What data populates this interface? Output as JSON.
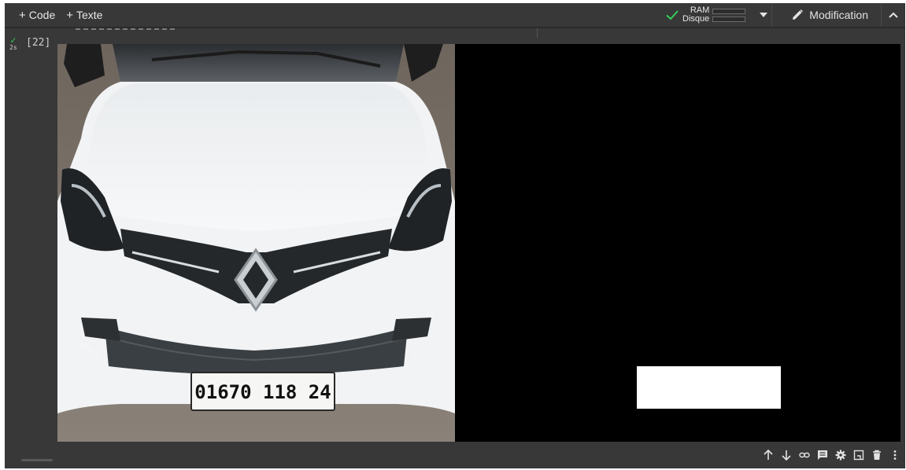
{
  "toolbar": {
    "add_code": {
      "plus": "+",
      "label": "Code"
    },
    "add_text": {
      "plus": "+",
      "label": "Texte"
    },
    "resources": {
      "ram_label": "RAM",
      "disk_label": "Disque"
    },
    "edit_label": "Modification"
  },
  "cell": {
    "status_tick": "✓",
    "exec_time": "2s",
    "exec_count": "[22]"
  },
  "output": {
    "plate_number": "01670 118 24",
    "panels": [
      "car-photo",
      "plate-mask"
    ]
  },
  "cell_toolbar": {
    "icons": [
      "arrow-up-icon",
      "arrow-down-icon",
      "link-icon",
      "comment-icon",
      "gear-icon",
      "mirror-cell-icon",
      "trash-icon",
      "more-vert-icon"
    ]
  },
  "colors": {
    "background": "#383838",
    "accent_check": "#34d058",
    "text": "#e3e3e3"
  }
}
